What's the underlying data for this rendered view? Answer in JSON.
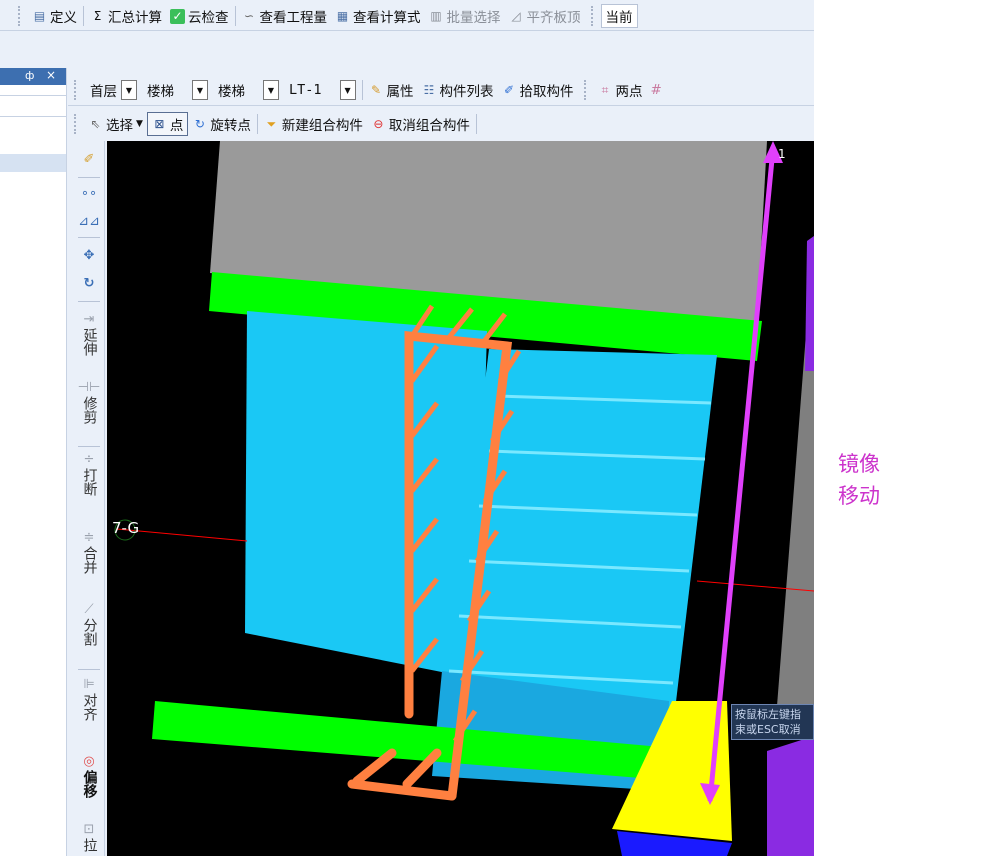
{
  "toolbar_top": {
    "items": [
      {
        "label": "定义",
        "icon": "define-icon"
      },
      {
        "label": "汇总计算",
        "icon": "sigma-icon"
      },
      {
        "label": "云检查",
        "icon": "cloud-check-icon"
      },
      {
        "label": "查看工程量",
        "icon": "view-quantity-icon"
      },
      {
        "label": "查看计算式",
        "icon": "view-formula-icon"
      },
      {
        "label": "批量选择",
        "icon": "batch-select-icon"
      },
      {
        "label": "平齐板顶",
        "icon": "align-slab-icon"
      }
    ],
    "current_label": "当前"
  },
  "left_panel": {
    "pin": "ф",
    "close": "×"
  },
  "toolbar_row2": {
    "floor": "首层",
    "type1": "楼梯",
    "type2": "楼梯",
    "component": "LT-1",
    "properties": "属性",
    "component_list": "构件列表",
    "pick_component": "拾取构件",
    "two_points": "两点",
    "grid_glyph": "#"
  },
  "toolbar_row3": {
    "select": "选择",
    "point": "点",
    "rotate_point": "旋转点",
    "new_group": "新建组合构件",
    "cancel_group": "取消组合构件"
  },
  "vertical_toolbar": [
    {
      "label": "",
      "icon": "brush-icon"
    },
    {
      "label": "",
      "icon": "copy-icon"
    },
    {
      "label": "",
      "icon": "mirror-icon"
    },
    {
      "label": "",
      "icon": "move-icon"
    },
    {
      "label": "",
      "icon": "rotate-icon"
    },
    {
      "label": "延伸",
      "icon": "extend-icon"
    },
    {
      "label": "修剪",
      "icon": "trim-icon"
    },
    {
      "label": "打断",
      "icon": "break-icon"
    },
    {
      "label": "合并",
      "icon": "merge-icon"
    },
    {
      "label": "分割",
      "icon": "split-icon"
    },
    {
      "label": "对齐",
      "icon": "align-icon"
    },
    {
      "label": "偏移",
      "icon": "offset-icon"
    },
    {
      "label": "拉",
      "icon": "stretch-icon"
    }
  ],
  "viewport": {
    "point_label": "7-G",
    "tooltip_line1": "按鼠标左键指",
    "tooltip_line2": "束或ESC取消",
    "axis_mark": "1"
  },
  "annotation": {
    "line1": "镜像",
    "line2": "移动"
  },
  "colors": {
    "stair_fill": "#1ac8f5",
    "stair_edge": "#5fe0ff",
    "slab_gray": "#9a9a9a",
    "beam_green": "#00ff00",
    "rebar_orange": "#ff8040",
    "arrow_magenta": "#e040fb",
    "block_yellow": "#ffff00",
    "block_purple": "#8a2be2",
    "block_blue": "#1a1aff"
  }
}
